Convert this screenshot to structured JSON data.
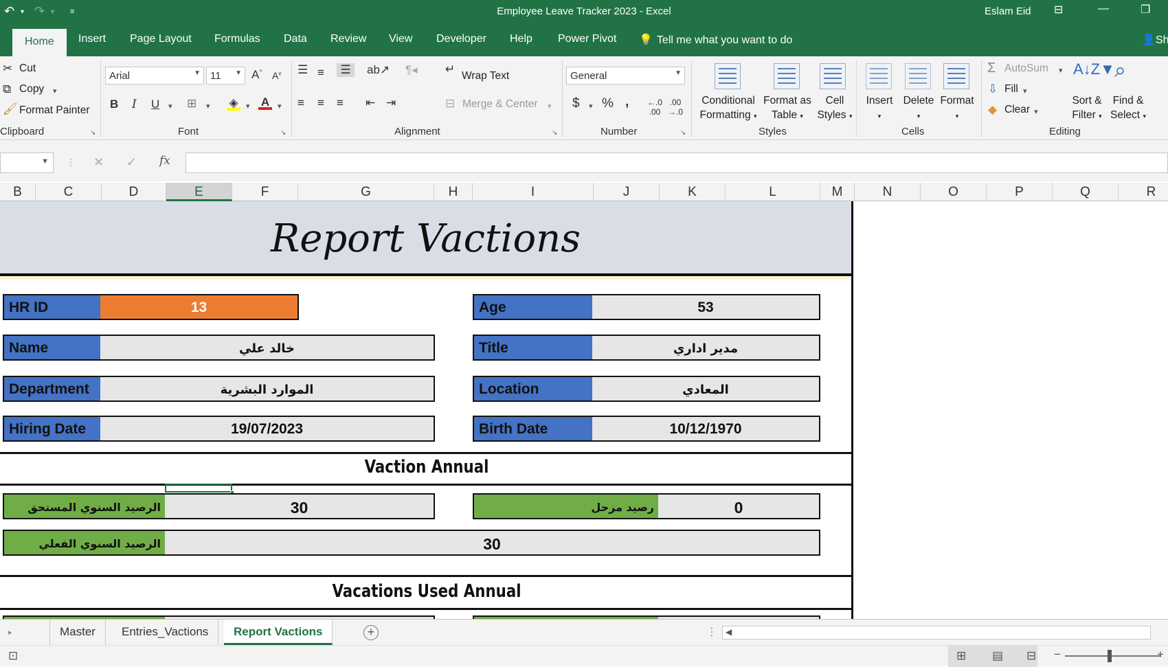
{
  "window": {
    "title": "Employee Leave Tracker 2023  -  Excel",
    "user": "Eslam Eid",
    "undo_icon": "undo-icon",
    "redo_icon": "redo-icon"
  },
  "ribbon_tabs": [
    "Home",
    "Insert",
    "Page Layout",
    "Formulas",
    "Data",
    "Review",
    "View",
    "Developer",
    "Help",
    "Power Pivot",
    "Tell me what you want to do",
    "Sh"
  ],
  "clipboard": {
    "cut": "Cut",
    "copy": "Copy",
    "painter": "Format Painter",
    "label": "Clipboard"
  },
  "font": {
    "name": "Arial",
    "size": "11",
    "bold": "B",
    "italic": "I",
    "underline": "U",
    "label": "Font"
  },
  "alignment": {
    "wrap": "Wrap Text",
    "merge": "Merge & Center",
    "label": "Alignment"
  },
  "number": {
    "format": "General",
    "currency": "$",
    "percent": "%",
    "comma": ",",
    "label": "Number"
  },
  "styles": {
    "conditional_1": "Conditional",
    "conditional_2": "Formatting",
    "table_1": "Format as",
    "table_2": "Table",
    "cell_1": "Cell",
    "cell_2": "Styles",
    "label": "Styles"
  },
  "cells": {
    "insert": "Insert",
    "delete": "Delete",
    "format": "Format",
    "label": "Cells"
  },
  "editing": {
    "autosum": "AutoSum",
    "fill": "Fill",
    "clear": "Clear",
    "sort_1": "Sort &",
    "sort_2": "Filter",
    "find_1": "Find &",
    "find_2": "Select",
    "label": "Editing"
  },
  "formula_bar": {
    "name_box": "",
    "fx": "fx",
    "cancel": "✕",
    "enter": "✓",
    "value": ""
  },
  "columns": [
    "B",
    "C",
    "D",
    "E",
    "F",
    "G",
    "H",
    "I",
    "J",
    "K",
    "L",
    "M",
    "N",
    "O",
    "P",
    "Q",
    "R"
  ],
  "selected_column": "E",
  "report": {
    "title": "Report Vactions",
    "fields": {
      "hr_id_label": "HR ID",
      "hr_id": "13",
      "age_label": "Age",
      "age": "53",
      "name_label": "Name",
      "name": "خالد علي",
      "title_label": "Title",
      "title": "مدير اداري",
      "department_label": "Department",
      "department": "الموارد البشرية",
      "location_label": "Location",
      "location": "المعادي",
      "hiring_label": "Hiring Date",
      "hiring": "19/07/2023",
      "birth_label": "Birth Date",
      "birth": "10/12/1970"
    },
    "annual_heading": "Vaction Annual",
    "annual": {
      "due_label": "الرصيد السنوي المستحق",
      "due": "30",
      "carried_label": "رصيد مرحل",
      "carried": "0",
      "actual_label": "الرصيد السنوي الفعلي",
      "actual": "30"
    },
    "used_heading": "Vacations Used Annual"
  },
  "sheet_tabs": [
    "Master",
    "Entries_Vactions",
    "Report Vactions"
  ],
  "active_sheet": "Report Vactions",
  "colors": {
    "excel_green": "#217346",
    "label_blue": "#4472c4",
    "label_green": "#70ad47",
    "id_orange": "#ed7d31"
  }
}
